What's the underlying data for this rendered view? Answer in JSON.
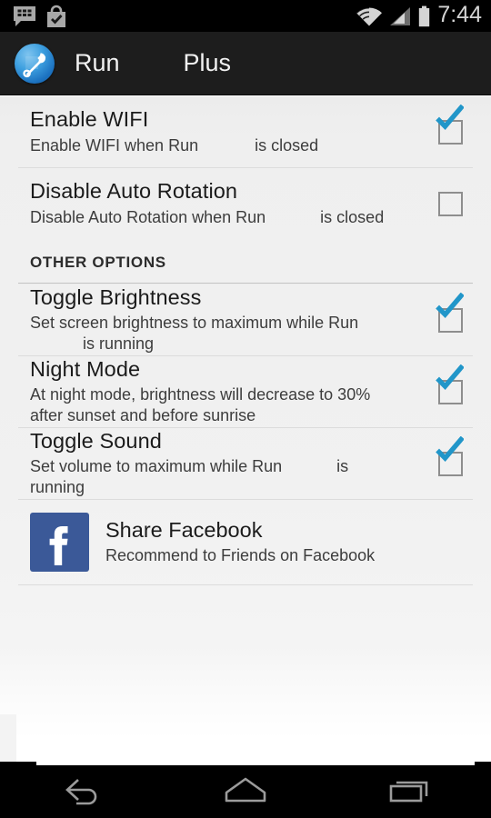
{
  "status_bar": {
    "icons": [
      "bbm-chat-icon",
      "play-store-bag-icon"
    ],
    "wifi_icon": "wifi-icon",
    "signal_icon": "cellular-signal-icon",
    "battery_icon": "battery-icon",
    "clock": "7:44"
  },
  "action_bar": {
    "app_icon": "app-tool-icon",
    "title": "Run",
    "title_suffix": "Plus"
  },
  "settings": {
    "rows": [
      {
        "title": "Enable WIFI",
        "sub_before": "Enable WIFI when Run",
        "sub_after": "is closed",
        "checked": true
      },
      {
        "title": "Disable Auto Rotation",
        "sub_before": "Disable Auto Rotation when Run",
        "sub_after": "is closed",
        "checked": false
      }
    ]
  },
  "section": {
    "header": "OTHER OPTIONS",
    "rows": [
      {
        "title": "Toggle Brightness",
        "sub_before": "Set screen brightness to maximum while Run",
        "sub_after": "is running",
        "checked": true
      },
      {
        "title": "Night Mode",
        "sub_before": "At night mode, brightness will decrease to 30% after sunset and before sunrise",
        "sub_after": "",
        "checked": true
      },
      {
        "title": "Toggle Sound",
        "sub_before": "Set volume to maximum while Run",
        "sub_after": "is running",
        "checked": true
      }
    ]
  },
  "facebook": {
    "icon": "facebook-icon",
    "title": "Share Facebook",
    "sub": "Recommend to Friends on Facebook",
    "brand_color": "#3b5998"
  },
  "nav_bar": {
    "back": "back-icon",
    "home": "home-icon",
    "recents": "recents-icon"
  },
  "colors": {
    "accent_check": "#2196c9",
    "status_bar_bg": "#000000",
    "action_bar_bg": "#1d1d1d",
    "list_bg": "#f1f1f1"
  }
}
